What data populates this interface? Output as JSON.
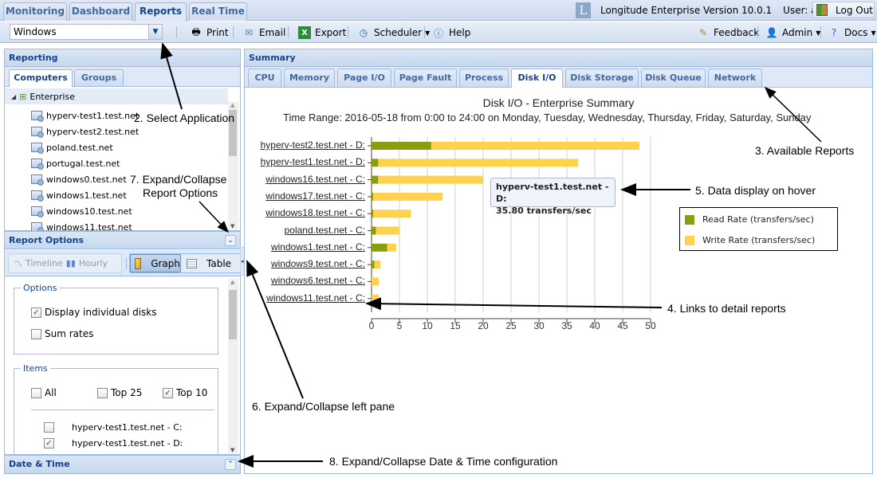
{
  "nav": {
    "tabs": [
      {
        "label": "Monitoring",
        "active": false
      },
      {
        "label": "Dashboard",
        "active": false
      },
      {
        "label": "Reports",
        "active": true
      },
      {
        "label": "Real Time",
        "active": false
      }
    ],
    "logo_letter": "L",
    "version": "Longitude Enterprise Version 10.0.1",
    "user": "User: admin",
    "logout_label": "Log Out"
  },
  "toolbar": {
    "application_select": "Windows",
    "print": "Print",
    "email": "Email",
    "export": "Export",
    "scheduler": "Scheduler",
    "help": "Help",
    "feedback": "Feedback",
    "admin": "Admin",
    "docs": "Docs"
  },
  "reporting": {
    "title": "Reporting",
    "tabs": [
      {
        "label": "Computers",
        "active": true
      },
      {
        "label": "Groups",
        "active": false
      }
    ],
    "root": "Enterprise",
    "items": [
      "hyperv-test1.test.net",
      "hyperv-test2.test.net",
      "poland.test.net",
      "portugal.test.net",
      "windows0.test.net",
      "windows1.test.net",
      "windows10.test.net",
      "windows11.test.net"
    ]
  },
  "report_options": {
    "title": "Report Options",
    "timeline": "Timeline",
    "hourly": "Hourly",
    "graph": "Graph",
    "table": "Table",
    "options_legend": "Options",
    "display_individual_disks": {
      "label": "Display individual disks",
      "checked": true
    },
    "sum_rates": {
      "label": "Sum rates",
      "checked": false
    },
    "items_legend": "Items",
    "all": {
      "label": "All",
      "checked": false
    },
    "top25": {
      "label": "Top 25",
      "checked": false
    },
    "top10": {
      "label": "Top 10",
      "checked": true
    },
    "item_list": [
      {
        "label": "hyperv-test1.test.net - C:",
        "checked": false
      },
      {
        "label": "hyperv-test1.test.net - D:",
        "checked": true
      }
    ]
  },
  "date_time": {
    "title": "Date & Time"
  },
  "summary": {
    "title": "Summary",
    "tabs": [
      {
        "label": "CPU",
        "active": false
      },
      {
        "label": "Memory",
        "active": false
      },
      {
        "label": "Page I/O",
        "active": false
      },
      {
        "label": "Page Fault",
        "active": false
      },
      {
        "label": "Process",
        "active": false
      },
      {
        "label": "Disk I/O",
        "active": true
      },
      {
        "label": "Disk Storage",
        "active": false
      },
      {
        "label": "Disk Queue",
        "active": false
      },
      {
        "label": "Network",
        "active": false
      }
    ]
  },
  "tooltip": {
    "line1": "hyperv-test1.test.net - D:",
    "line2": "35.80 transfers/sec"
  },
  "annotations": {
    "a2": "2. Select Application",
    "a3": "3. Available Reports",
    "a4": "4. Links to detail reports",
    "a5": "5. Data display on hover",
    "a6": "6. Expand/Collapse left pane",
    "a7_line1": "7. Expand/Collapse",
    "a7_line2": "Report Options",
    "a8": "8. Expand/Collapse Date & Time configuration"
  },
  "chart_data": {
    "type": "bar",
    "orientation": "horizontal",
    "stacked": true,
    "title": "Disk I/O - Enterprise Summary",
    "subtitle": "Time Range: 2016-05-18 from 0:00 to 24:00 on Monday, Tuesday, Wednesday, Thursday, Friday, Saturday, Sunday",
    "xlabel": "",
    "ylabel": "",
    "xlim": [
      0,
      50
    ],
    "xticks": [
      0,
      5,
      10,
      15,
      20,
      25,
      30,
      35,
      40,
      45,
      50
    ],
    "grid": true,
    "legend_position": "right",
    "categories": [
      "hyperv-test2.test.net - D:",
      "hyperv-test1.test.net - D:",
      "windows16.test.net - C:",
      "windows17.test.net - C:",
      "windows18.test.net - C:",
      "poland.test.net - C:",
      "windows1.test.net - C:",
      "windows9.test.net - C:",
      "windows6.test.net - C:",
      "windows11.test.net - C:"
    ],
    "series": [
      {
        "name": "Read Rate (transfers/sec)",
        "color": "#8b9d0f",
        "values": [
          10.7,
          1.2,
          1.2,
          0.3,
          0.3,
          0.8,
          2.8,
          0.5,
          0.0,
          0.0
        ]
      },
      {
        "name": "Write Rate (transfers/sec)",
        "color": "#ffd24d",
        "values": [
          37.3,
          35.8,
          18.8,
          12.4,
          6.8,
          4.2,
          1.6,
          1.1,
          1.3,
          1.3
        ]
      }
    ]
  }
}
